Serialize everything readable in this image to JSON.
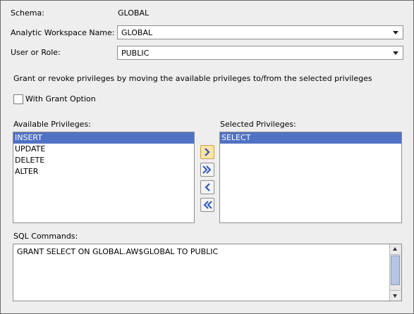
{
  "schema": {
    "label": "Schema:",
    "value": "GLOBAL"
  },
  "workspace": {
    "label": "Analytic Workspace Name:",
    "value": "GLOBAL"
  },
  "user_role": {
    "label": "User or Role:",
    "value": "PUBLIC"
  },
  "instructions": "Grant or revoke privileges by moving the available privileges to/from the selected privileges",
  "grant_option": {
    "label": "With Grant Option",
    "checked": false
  },
  "available": {
    "label": "Available Privileges:",
    "items": [
      "INSERT",
      "UPDATE",
      "DELETE",
      "ALTER"
    ],
    "selected_index": 0
  },
  "selected": {
    "label": "Selected Privileges:",
    "items": [
      "SELECT"
    ],
    "selected_index": 0
  },
  "buttons": {
    "add": "chevron-right-icon",
    "add_all": "double-chevron-right-icon",
    "remove": "chevron-left-icon",
    "remove_all": "double-chevron-left-icon"
  },
  "sql": {
    "label": "SQL Commands:",
    "text": "GRANT SELECT ON GLOBAL.AW$GLOBAL TO PUBLIC"
  },
  "colors": {
    "selection": "#4f72c4",
    "active_button": "#fbe4a8",
    "background": "#eeeeee"
  }
}
